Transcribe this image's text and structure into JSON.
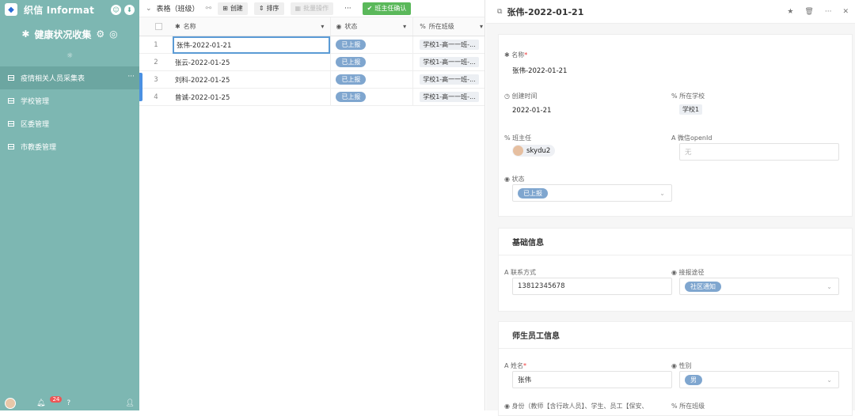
{
  "app": {
    "brand": "织信 Informat",
    "name": "健康状况收集"
  },
  "sidebar": {
    "items": [
      {
        "label": "疫情相关人员采集表"
      },
      {
        "label": "学校管理"
      },
      {
        "label": "区委管理"
      },
      {
        "label": "市教委管理"
      }
    ],
    "notification_count": "24"
  },
  "toolbar": {
    "title": "表格（班级）",
    "create": "创建",
    "sort": "排序",
    "batch": "批量操作",
    "more": "···",
    "confirm": "班主任确认"
  },
  "table": {
    "columns": [
      "名称",
      "状态",
      "所在班级"
    ],
    "rows": [
      {
        "n": "1",
        "name": "张伟-2022-01-21",
        "status": "已上报",
        "class": "学校1-高一一班-..."
      },
      {
        "n": "2",
        "name": "张云-2022-01-25",
        "status": "已上报",
        "class": "学校1-高一一班-..."
      },
      {
        "n": "3",
        "name": "刘科-2022-01-25",
        "status": "已上报",
        "class": "学校1-高一一班-..."
      },
      {
        "n": "4",
        "name": "曾诚-2022-01-25",
        "status": "已上报",
        "class": "学校1-高一一班-..."
      }
    ]
  },
  "record": {
    "title": "张伟-2022-01-21",
    "name_label": "名称",
    "name_value": "张伟-2022-01-21",
    "created_label": "创建时间",
    "created_value": "2022-01-21",
    "school_label": "所在学校",
    "school_value": "学校1",
    "teacher_label": "班主任",
    "teacher_value": "skydu2",
    "openid_label": "微信openId",
    "openid_placeholder": "无",
    "status_label": "状态",
    "status_value": "已上报",
    "section_basic": "基础信息",
    "contact_label": "联系方式",
    "contact_value": "13812345678",
    "source_label": "接报途径",
    "source_value": "社区通知",
    "section_staff": "师生员工信息",
    "person_label": "姓名",
    "person_value": "张伟",
    "gender_label": "性别",
    "gender_value": "男",
    "identity_label": "身份（教师【含行政人员】、学生、员工【保安、",
    "class_label": "所在班级"
  }
}
